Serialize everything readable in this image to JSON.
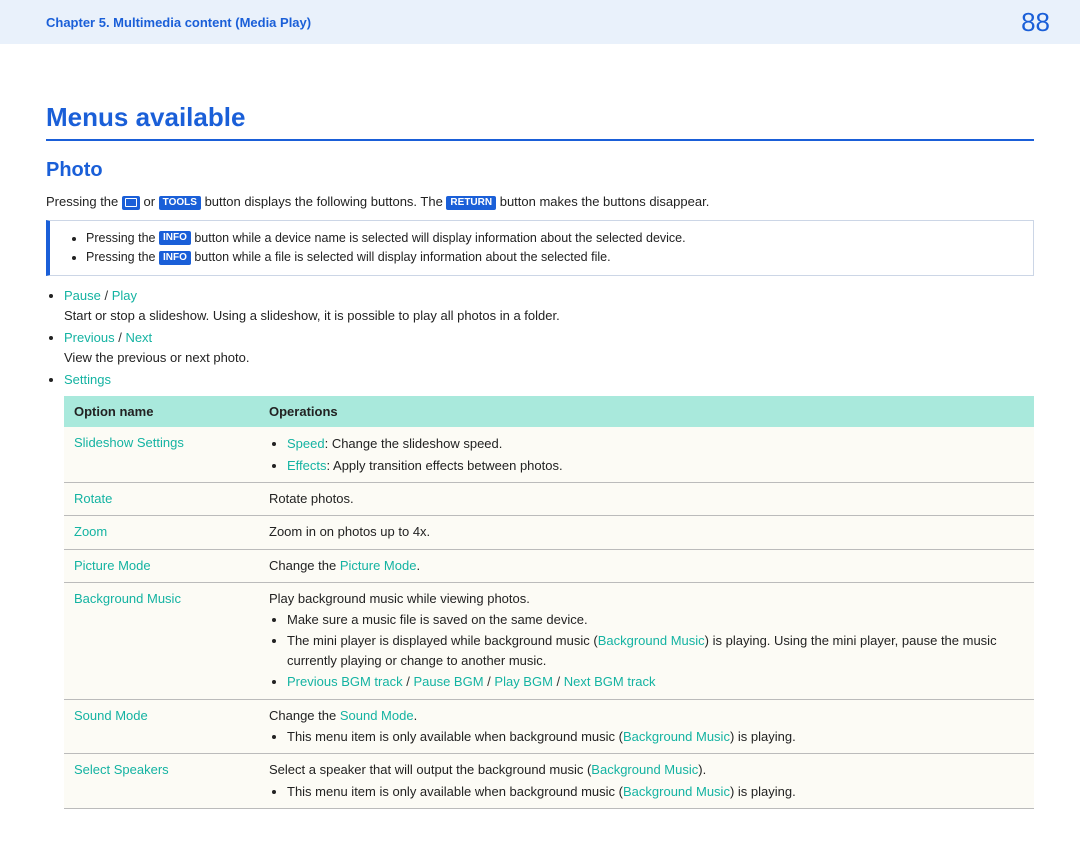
{
  "header": {
    "chapter": "Chapter 5. Multimedia content (Media Play)",
    "page_number": "88"
  },
  "headings": {
    "main": "Menus available",
    "section": "Photo"
  },
  "intro": {
    "p1a": "Pressing the ",
    "p1b": " or ",
    "p1c": " button displays the following buttons. The ",
    "p1d": " button makes the buttons disappear.",
    "tools_chip": "TOOLS",
    "return_chip": "RETURN",
    "info_chip": "INFO"
  },
  "info_box": {
    "line1a": "Pressing the ",
    "line1b": " button while a device name is selected will display information about the selected device.",
    "line2a": "Pressing the ",
    "line2b": " button while a file is selected will display information about the selected file."
  },
  "bullets": {
    "pause": "Pause",
    "play": "Play",
    "pause_play_desc": "Start or stop a slideshow. Using a slideshow, it is possible to play all photos in a folder.",
    "previous": "Previous",
    "next": "Next",
    "prev_next_desc": "View the previous or next photo.",
    "settings": "Settings",
    "slash": " / "
  },
  "table": {
    "head_option": "Option name",
    "head_ops": "Operations",
    "rows": {
      "slideshow_settings": {
        "name": "Slideshow Settings",
        "speed_label": "Speed",
        "speed_text": ": Change the slideshow speed.",
        "effects_label": "Effects",
        "effects_text": ": Apply transition effects between photos."
      },
      "rotate": {
        "name": "Rotate",
        "op": "Rotate photos."
      },
      "zoom": {
        "name": "Zoom",
        "op": "Zoom in on photos up to 4x."
      },
      "picture_mode": {
        "name": "Picture Mode",
        "op_a": "Change the ",
        "op_link": "Picture Mode",
        "op_b": "."
      },
      "background_music": {
        "name": "Background Music",
        "lead": "Play background music while viewing photos.",
        "b1": "Make sure a music file is saved on the same device.",
        "b2a": "The mini player is displayed while background music (",
        "b2_link": "Background Music",
        "b2b": ") is playing. Using the mini player, pause the music currently playing or change to another music.",
        "b3_prev": "Previous BGM track",
        "b3_pause": "Pause BGM",
        "b3_play": "Play BGM",
        "b3_next": "Next BGM track"
      },
      "sound_mode": {
        "name": "Sound Mode",
        "op_a": "Change the ",
        "op_link": "Sound Mode",
        "op_b": ".",
        "b1a": "This menu item is only available when background music (",
        "b1_link": "Background Music",
        "b1b": ") is playing."
      },
      "select_speakers": {
        "name": "Select Speakers",
        "op_a": "Select a speaker that will output the background music (",
        "op_link": "Background Music",
        "op_b": ").",
        "b1a": "This menu item is only available when background music (",
        "b1_link": "Background Music",
        "b1b": ") is playing."
      }
    }
  }
}
